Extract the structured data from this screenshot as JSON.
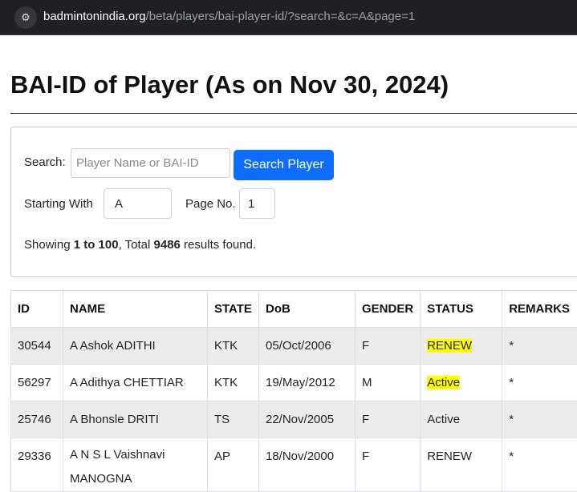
{
  "browser": {
    "url_domain": "badmintonindia.org",
    "url_path": "/beta/players/bai-player-id/?search=&c=A&page=1"
  },
  "page": {
    "title": "BAI-ID of Player (As on Nov 30, 2024)"
  },
  "search": {
    "label": "Search:",
    "placeholder": "Player Name or BAI-ID",
    "button": "Search Player",
    "starting_label": "Starting With",
    "starting_value": "A",
    "page_label": "Page No.",
    "page_value": "1",
    "summary_prefix": "Showing ",
    "summary_range": "1 to 100",
    "summary_mid": ", Total ",
    "summary_total": "9486",
    "summary_suffix": " results found."
  },
  "table": {
    "headers": [
      "ID",
      "NAME",
      "STATE",
      "DoB",
      "GENDER",
      "STATUS",
      "REMARKS"
    ],
    "rows": [
      {
        "id": "30544",
        "name": "A Ashok ADITHI",
        "state": "KTK",
        "dob": "05/Oct/2006",
        "gender": "F",
        "status": "RENEW",
        "remarks": "*"
      },
      {
        "id": "56297",
        "name": "A Adithya CHETTIAR",
        "state": "KTK",
        "dob": "19/May/2012",
        "gender": "M",
        "status": "Active",
        "remarks": "*"
      },
      {
        "id": "25746",
        "name": "A Bhonsle DRITI",
        "state": "TS",
        "dob": "22/Nov/2005",
        "gender": "F",
        "status": "Active",
        "remarks": "*"
      },
      {
        "id": "29336",
        "name": "A N S L Vaishnavi MANOGNA",
        "state": "AP",
        "dob": "18/Nov/2000",
        "gender": "F",
        "status": "RENEW",
        "remarks": "*"
      }
    ]
  }
}
